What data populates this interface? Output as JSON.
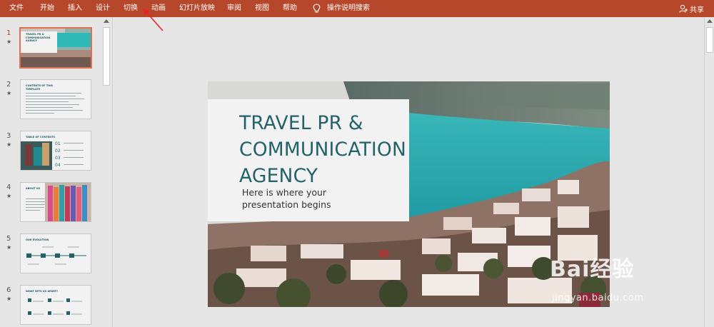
{
  "menu": {
    "items": [
      "文件",
      "开始",
      "插入",
      "设计",
      "切换",
      "动画",
      "幻灯片放映",
      "审阅",
      "视图",
      "帮助"
    ],
    "search_label": "操作说明搜索",
    "share_label": "共享"
  },
  "thumbnails": {
    "numbers": [
      "1",
      "2",
      "3",
      "4",
      "5",
      "6"
    ],
    "titles": [
      "TRAVEL PR & COMMUNICATION AGENCY",
      "CONTENTS OF THIS TEMPLATE",
      "TABLE OF CONTENTS",
      "ABOUT US",
      "OUR EVOLUTION",
      "WHAT SETS US APART?"
    ],
    "toc_numbers": [
      "01",
      "02",
      "03",
      "04"
    ]
  },
  "slide": {
    "title": "TRAVEL PR & COMMUNICATION AGENCY",
    "subtitle": "Here is where your presentation begins"
  },
  "watermark": {
    "text": "Bai经验",
    "url": "jingyan.baidu.com"
  },
  "colors": {
    "ribbon": "#b7472a",
    "title_teal": "#24626a",
    "selected_border": "#e07050"
  }
}
